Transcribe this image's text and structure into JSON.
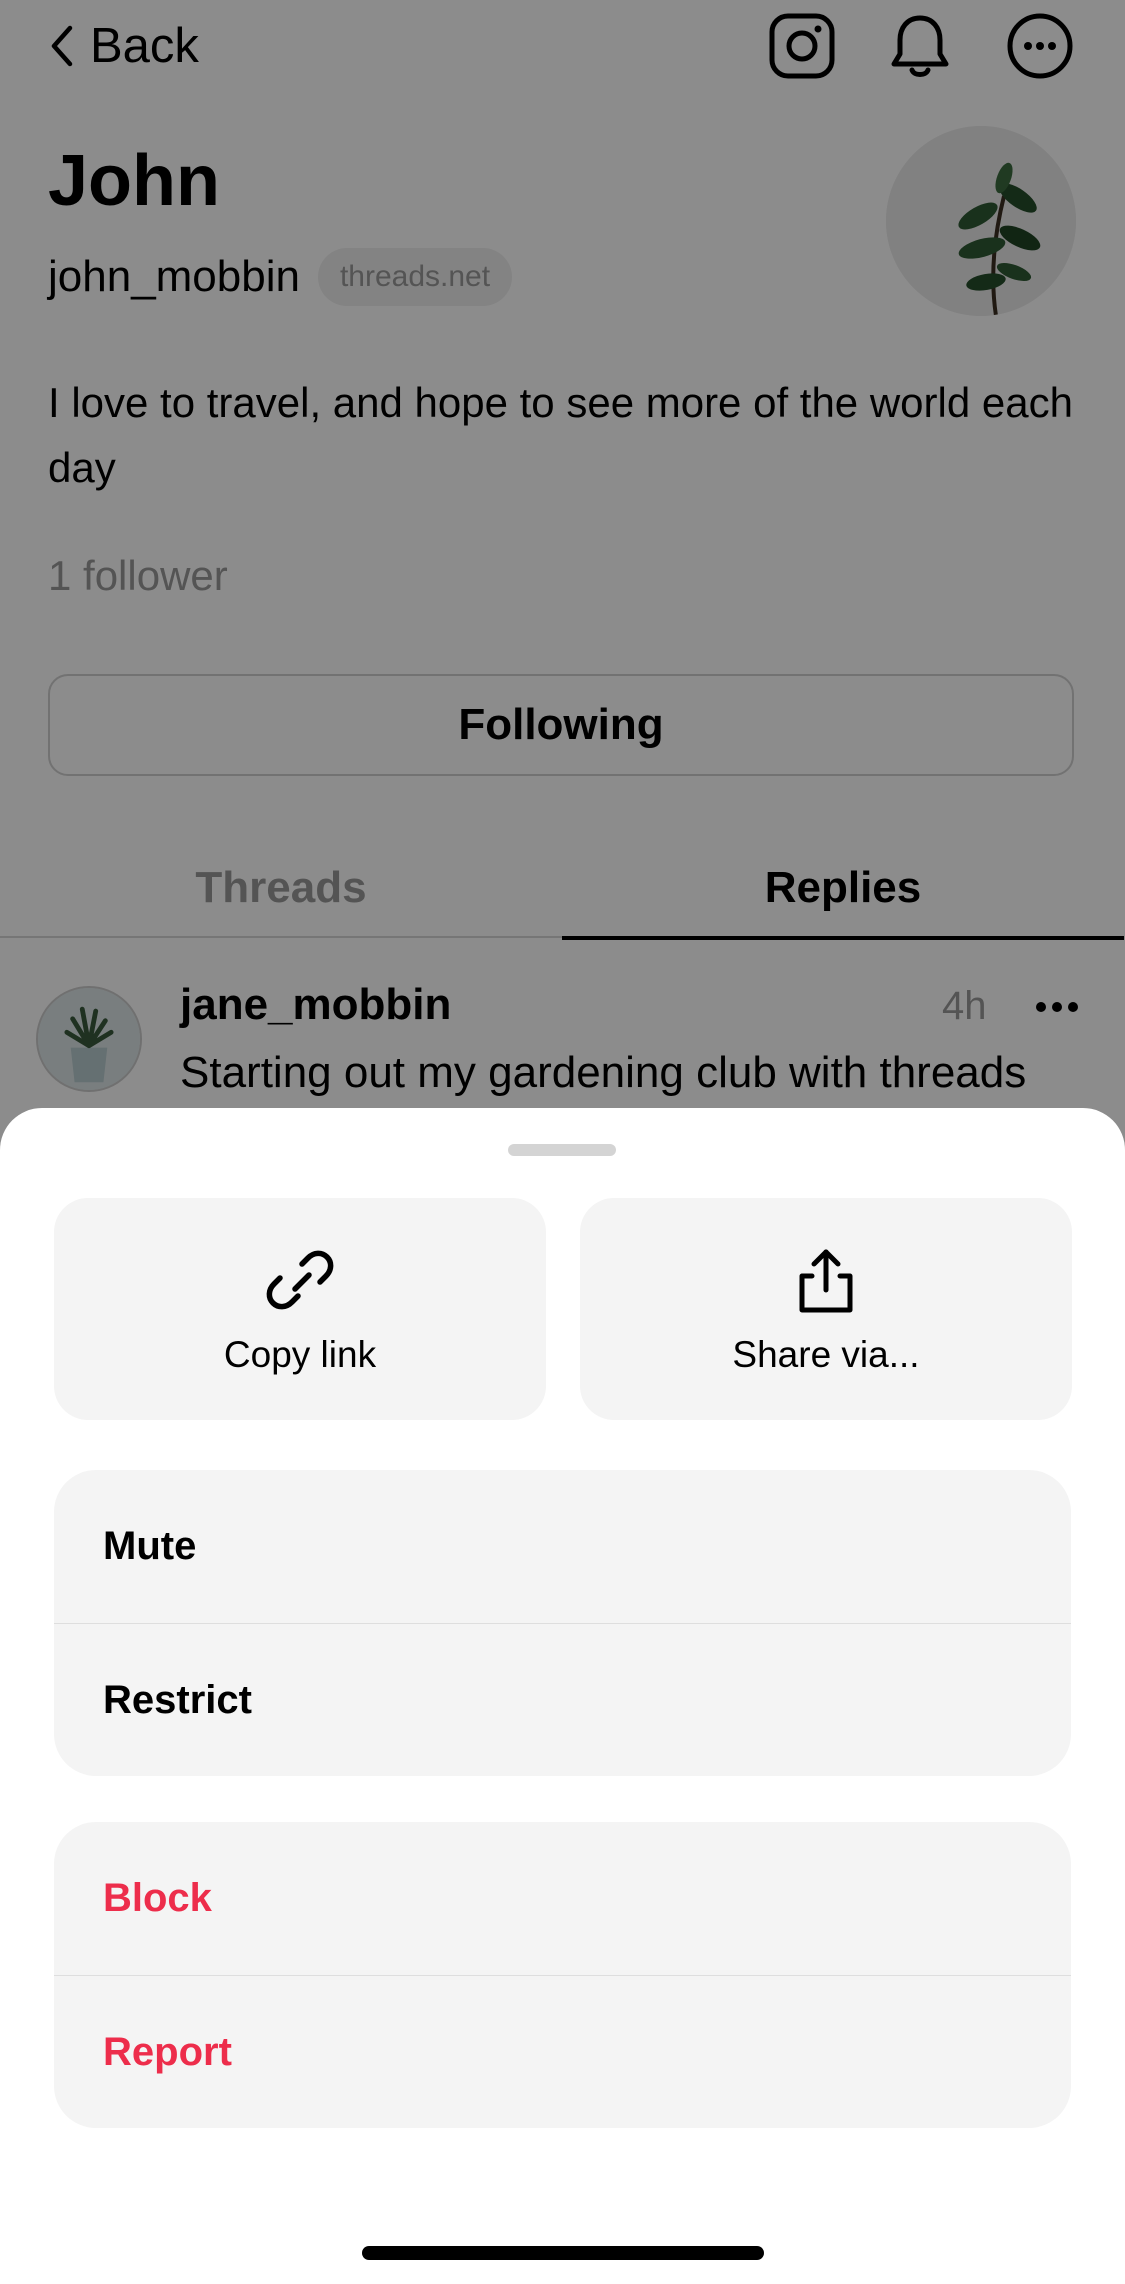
{
  "header": {
    "back_label": "Back",
    "icons": [
      "instagram-icon",
      "bell-icon",
      "more-icon"
    ]
  },
  "profile": {
    "name": "John",
    "handle": "john_mobbin",
    "domain": "threads.net",
    "bio": "I love to travel, and hope to see more of the world each day",
    "followers": "1 follower",
    "follow_button": "Following"
  },
  "tabs": [
    {
      "label": "Threads",
      "active": false
    },
    {
      "label": "Replies",
      "active": true
    }
  ],
  "post": {
    "username": "jane_mobbin",
    "time": "4h",
    "text": "Starting out my gardening club with threads"
  },
  "sheet": {
    "actions": [
      {
        "label": "Copy link",
        "icon": "link-icon"
      },
      {
        "label": "Share via...",
        "icon": "share-icon"
      }
    ],
    "group1": [
      "Mute",
      "Restrict"
    ],
    "group2": [
      "Block",
      "Report"
    ]
  },
  "colors": {
    "danger": "#ed2d4b",
    "overlay": "rgba(0,0,0,0.45)",
    "card_bg": "#f4f4f4"
  }
}
